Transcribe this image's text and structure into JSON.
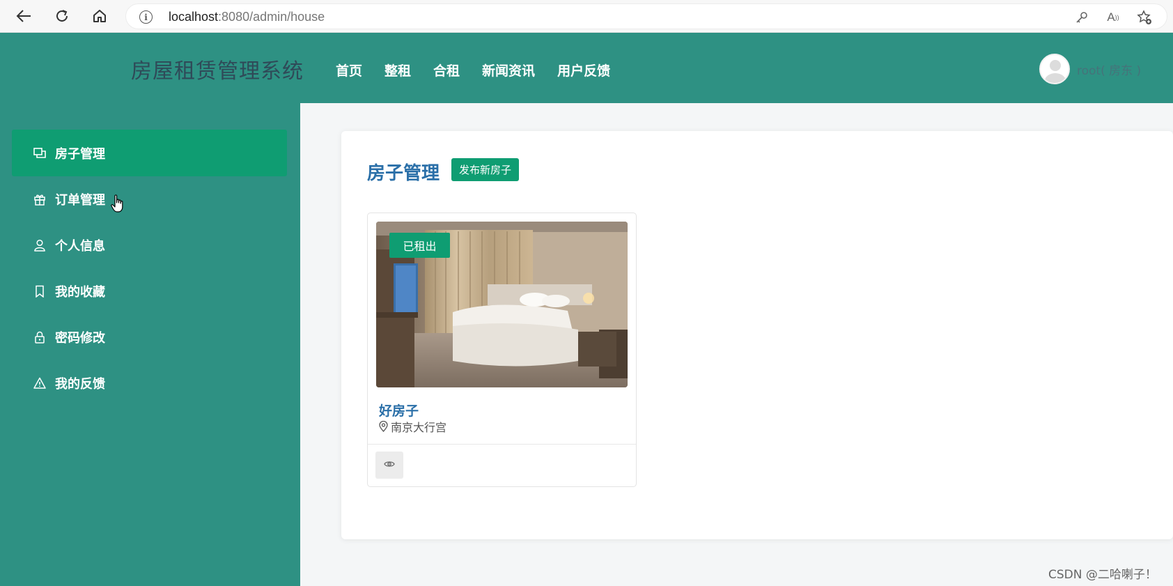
{
  "browser": {
    "url_host": "localhost",
    "url_rest": ":8080/admin/house"
  },
  "header": {
    "brand": "房屋租赁管理系统",
    "nav": [
      "首页",
      "整租",
      "合租",
      "新闻资讯",
      "用户反馈"
    ],
    "user": "root( 房东 )"
  },
  "sidebar": {
    "items": [
      {
        "label": "房子管理",
        "icon": "house-manage-icon",
        "active": true
      },
      {
        "label": "订单管理",
        "icon": "gift-icon",
        "active": false
      },
      {
        "label": "个人信息",
        "icon": "user-icon",
        "active": false
      },
      {
        "label": "我的收藏",
        "icon": "bookmark-icon",
        "active": false
      },
      {
        "label": "密码修改",
        "icon": "lock-icon",
        "active": false
      },
      {
        "label": "我的反馈",
        "icon": "warning-icon",
        "active": false
      }
    ]
  },
  "main": {
    "title": "房子管理",
    "publish_label": "发布新房子",
    "houses": [
      {
        "status": "已租出",
        "name": "好房子",
        "location": "南京大行宫"
      }
    ]
  },
  "watermark": "CSDN @二哈喇子！",
  "colors": {
    "header_bg": "#2e9183",
    "accent": "#0f9d72",
    "title_blue": "#2a6fa8"
  }
}
